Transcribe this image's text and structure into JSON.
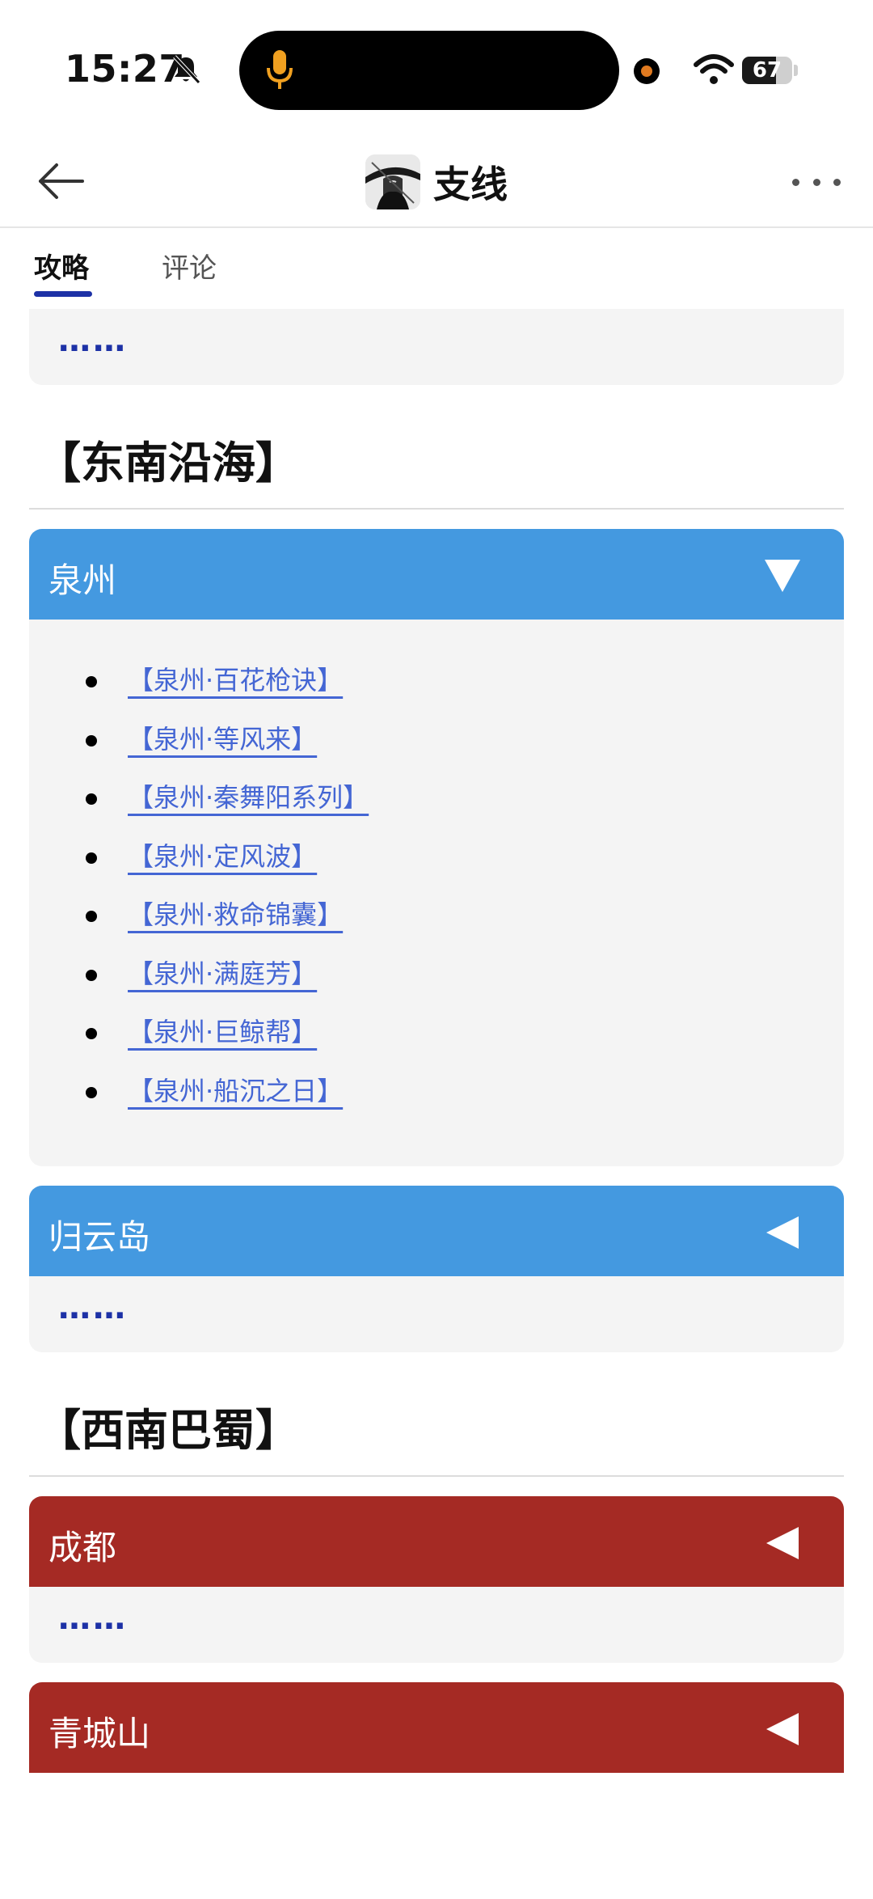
{
  "status_bar": {
    "time": "15:27",
    "battery_level": "67",
    "battery_fraction": 0.67,
    "icons": [
      "bell-muted-icon",
      "microphone-icon",
      "wifi-icon",
      "battery-icon"
    ]
  },
  "nav": {
    "title": "支线",
    "icons": [
      "back-arrow-icon",
      "more-icon"
    ]
  },
  "tabs": [
    {
      "label": "攻略",
      "active": true
    },
    {
      "label": "评论",
      "active": false
    }
  ],
  "top_panel": {
    "placeholder": "……"
  },
  "sections": [
    {
      "heading": "【东南沿海】",
      "panels": [
        {
          "title": "泉州",
          "color": "#4499e0",
          "expanded": true,
          "items": [
            "【泉州·百花枪诀】",
            "【泉州·等风来】",
            "【泉州·秦舞阳系列】",
            "【泉州·定风波】",
            "【泉州·救命锦囊】",
            "【泉州·满庭芳】",
            "【泉州·巨鲸帮】",
            "【泉州·船沉之日】"
          ]
        },
        {
          "title": "归云岛",
          "color": "#4499e0",
          "expanded": false,
          "placeholder": "……"
        }
      ]
    },
    {
      "heading": "【西南巴蜀】",
      "panels": [
        {
          "title": "成都",
          "color": "#a52a24",
          "expanded": false,
          "placeholder": "……"
        },
        {
          "title": "青城山",
          "color": "#a52a24",
          "expanded": false
        }
      ]
    }
  ],
  "colors": {
    "accent": "#1d31a6",
    "link": "#4466d4",
    "blue_header": "#4499e0",
    "red_header": "#a52a24",
    "panel_bg": "#f4f4f4"
  }
}
